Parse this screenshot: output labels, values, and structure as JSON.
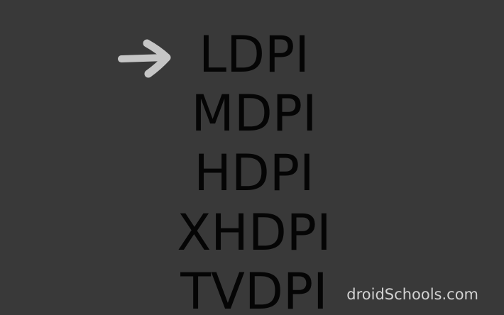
{
  "densities": [
    "LDPI",
    "MDPI",
    "HDPI",
    "XHDPI",
    "TVDPI"
  ],
  "selected_index": 0,
  "pointer_icon": "arrow-right-icon",
  "brand_text": "droidSchools.com",
  "colors": {
    "background": "#393939",
    "text": "#050505",
    "arrow": "#c6c6c6",
    "brand": "#d2d2d2"
  }
}
